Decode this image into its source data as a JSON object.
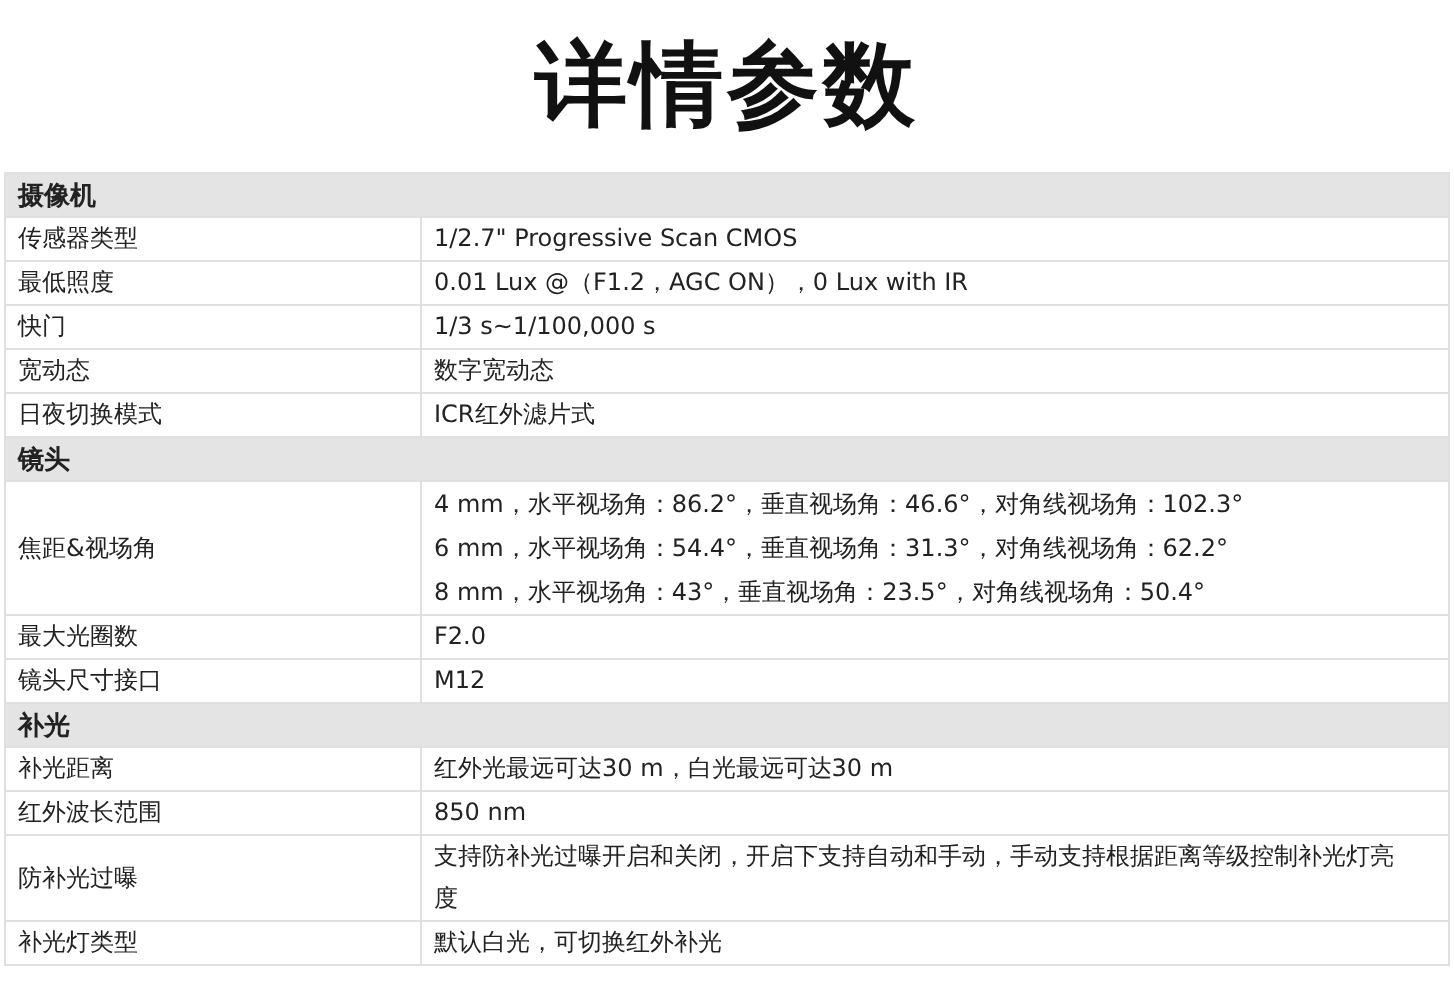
{
  "title": "详情参数",
  "sections": [
    {
      "heading": "摄像机",
      "rows": [
        {
          "label": "传感器类型",
          "values": [
            "1/2.7\" Progressive Scan CMOS"
          ]
        },
        {
          "label": "最低照度",
          "values": [
            "0.01 Lux @（F1.2，AGC ON），0 Lux with IR"
          ]
        },
        {
          "label": "快门",
          "values": [
            "1/3 s~1/100,000 s"
          ]
        },
        {
          "label": "宽动态",
          "values": [
            "数字宽动态"
          ]
        },
        {
          "label": "日夜切换模式",
          "values": [
            "ICR红外滤片式"
          ]
        }
      ]
    },
    {
      "heading": "镜头",
      "rows": [
        {
          "label": "焦距&视场角",
          "values": [
            "4 mm，水平视场角：86.2°，垂直视场角：46.6°，对角线视场角：102.3°",
            "6 mm，水平视场角：54.4°，垂直视场角：31.3°，对角线视场角：62.2°",
            "8 mm，水平视场角：43°，垂直视场角：23.5°，对角线视场角：50.4°"
          ]
        },
        {
          "label": "最大光圈数",
          "values": [
            "F2.0"
          ]
        },
        {
          "label": "镜头尺寸接口",
          "values": [
            "M12"
          ]
        }
      ]
    },
    {
      "heading": "补光",
      "rows": [
        {
          "label": "补光距离",
          "values": [
            "红外光最远可达30 m，白光最远可达30 m"
          ]
        },
        {
          "label": "红外波长范围",
          "values": [
            "850 nm"
          ]
        },
        {
          "label": "防补光过曝",
          "values": [
            "支持防补光过曝开启和关闭，开启下支持自动和手动，手动支持根据距离等级控制补光灯亮度"
          ]
        },
        {
          "label": "补光灯类型",
          "values": [
            "默认白光，可切换红外补光"
          ]
        }
      ]
    }
  ]
}
